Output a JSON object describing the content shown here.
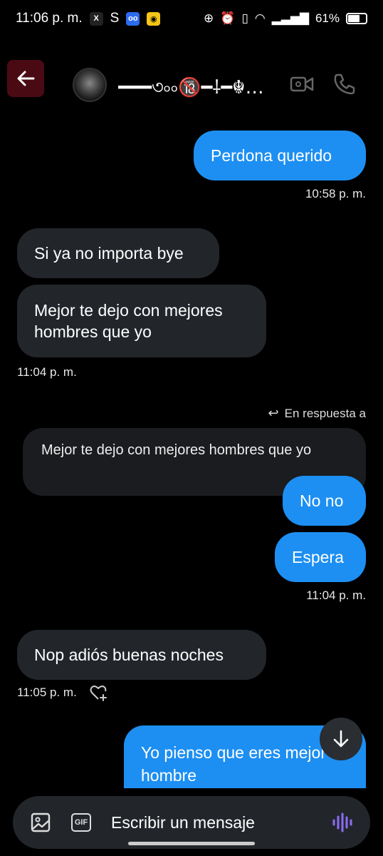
{
  "status_bar": {
    "time": "11:06 p. m.",
    "notif_x": "X",
    "notif_s": "S",
    "battery": "61%"
  },
  "header": {
    "contact_name": "━━━৩৹৹🔞━⸸━☬…"
  },
  "messages": [
    {
      "side": "out",
      "text": "Perdona querido"
    },
    {
      "timestamp": "10:58 p. m."
    },
    {
      "side": "in",
      "text": "Si ya no importa bye"
    },
    {
      "side": "in",
      "text": "Mejor te dejo con mejores hombres que yo"
    },
    {
      "timestamp": "11:04 p. m."
    },
    {
      "reply_label": "En respuesta a",
      "quoted": "Mejor te dejo con mejores hombres que yo"
    },
    {
      "side": "out",
      "text": "No no"
    },
    {
      "side": "out",
      "text": "Espera"
    },
    {
      "timestamp": "11:04 p. m."
    },
    {
      "side": "in",
      "text": "Nop adiós buenas noches"
    },
    {
      "timestamp": "11:05 p. m."
    },
    {
      "side": "out",
      "text": "Yo pienso que eres mejor hombre"
    }
  ],
  "composer": {
    "placeholder": "Escribir un mensaje",
    "gif_label": "GIF"
  },
  "colors": {
    "outgoing": "#1d8ff2",
    "incoming": "#22262b",
    "background": "#000000",
    "voice_icon": "#8e6cf5"
  }
}
